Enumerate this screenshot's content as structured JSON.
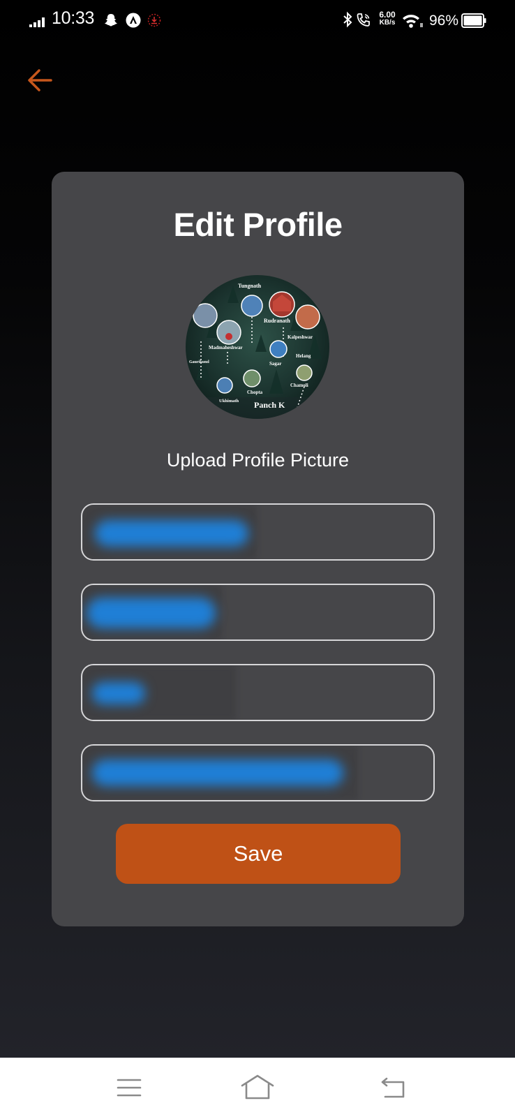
{
  "status_bar": {
    "time": "10:33",
    "net_speed_value": "6.00",
    "net_speed_unit": "KB/s",
    "battery_percent": "96%"
  },
  "header": {
    "back_icon": "arrow-left-icon",
    "accent_color": "#c7571c"
  },
  "card": {
    "title": "Edit Profile",
    "avatar": {
      "labels": [
        "Tungnath",
        "Rudranath",
        "Kalpeshwar",
        "Madmaheshwar",
        "Gaurikund",
        "Ukhimath",
        "Chopta",
        "Chamoli",
        "Sagar",
        "Helang",
        "Panch K"
      ]
    },
    "upload_label": "Upload Profile Picture",
    "fields": [
      {
        "name": "field-1",
        "value": "",
        "redacted": true
      },
      {
        "name": "field-2",
        "value": "",
        "redacted": true
      },
      {
        "name": "field-3",
        "value": "",
        "redacted": true
      },
      {
        "name": "field-4",
        "value": "",
        "redacted": true
      }
    ],
    "save_label": "Save",
    "save_color": "#bf5116"
  },
  "nav": {
    "menu_icon": "menu-icon",
    "home_icon": "home-icon",
    "back_icon": "back-icon"
  }
}
